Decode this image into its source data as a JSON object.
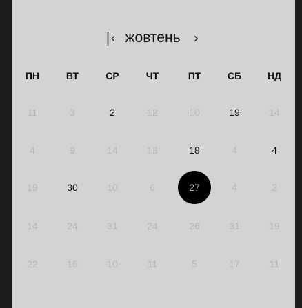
{
  "calendar": {
    "prev_label": "|‹",
    "month": "жовтень",
    "next_label": "›",
    "weekdays": [
      "ПН",
      "ВТ",
      "СР",
      "ЧТ",
      "ПТ",
      "СБ",
      "НД"
    ],
    "days": [
      {
        "label": "11",
        "style": "muted"
      },
      {
        "label": "3",
        "style": "muted"
      },
      {
        "label": "2",
        "style": "strong"
      },
      {
        "label": "12",
        "style": "muted"
      },
      {
        "label": "10",
        "style": "muted"
      },
      {
        "label": "19",
        "style": "strong"
      },
      {
        "label": "14",
        "style": "muted"
      },
      {
        "label": "4",
        "style": "muted"
      },
      {
        "label": "9",
        "style": "muted"
      },
      {
        "label": "14",
        "style": "muted"
      },
      {
        "label": "13",
        "style": "muted"
      },
      {
        "label": "18",
        "style": "strong"
      },
      {
        "label": "4",
        "style": "muted"
      },
      {
        "label": "4",
        "style": "strong"
      },
      {
        "label": "19",
        "style": "muted"
      },
      {
        "label": "30",
        "style": "strong"
      },
      {
        "label": "10",
        "style": "muted"
      },
      {
        "label": "6",
        "style": "muted"
      },
      {
        "label": "27",
        "style": "selected"
      },
      {
        "label": "4",
        "style": "muted"
      },
      {
        "label": "2",
        "style": "muted"
      },
      {
        "label": "14",
        "style": "muted"
      },
      {
        "label": "24",
        "style": "muted"
      },
      {
        "label": "31",
        "style": "muted"
      },
      {
        "label": "24",
        "style": "muted"
      },
      {
        "label": "26",
        "style": "muted"
      },
      {
        "label": "31",
        "style": "muted"
      },
      {
        "label": "19",
        "style": "muted"
      },
      {
        "label": "22",
        "style": "muted"
      },
      {
        "label": "16",
        "style": "muted"
      },
      {
        "label": "10",
        "style": "muted"
      },
      {
        "label": "11",
        "style": "muted"
      },
      {
        "label": "5",
        "style": "muted"
      },
      {
        "label": "17",
        "style": "muted"
      },
      {
        "label": "11",
        "style": "muted"
      }
    ]
  }
}
